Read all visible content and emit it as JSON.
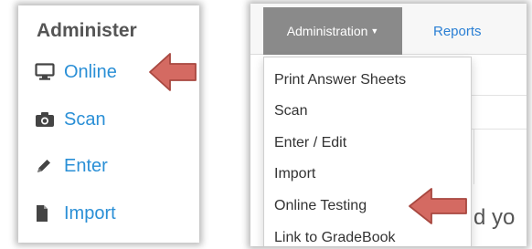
{
  "administer_panel": {
    "title": "Administer",
    "items": [
      {
        "label": "Online",
        "icon": "monitor-icon"
      },
      {
        "label": "Scan",
        "icon": "camera-icon"
      },
      {
        "label": "Enter",
        "icon": "pencil-icon"
      },
      {
        "label": "Import",
        "icon": "file-icon"
      }
    ]
  },
  "navbar": {
    "administration_label": "Administration",
    "reports_label": "Reports"
  },
  "dropdown": {
    "items": [
      {
        "label": "Print Answer Sheets"
      },
      {
        "label": "Scan"
      },
      {
        "label": "Enter / Edit"
      },
      {
        "label": "Import"
      },
      {
        "label": "Online Testing"
      },
      {
        "label": "Link to GradeBook"
      }
    ]
  },
  "background": {
    "partial_text": "d yo"
  },
  "colors": {
    "link": "#2a8fd6",
    "nav_active": "#8a8a8a",
    "arrow_fill": "#d46a62",
    "arrow_stroke": "#a84840"
  }
}
